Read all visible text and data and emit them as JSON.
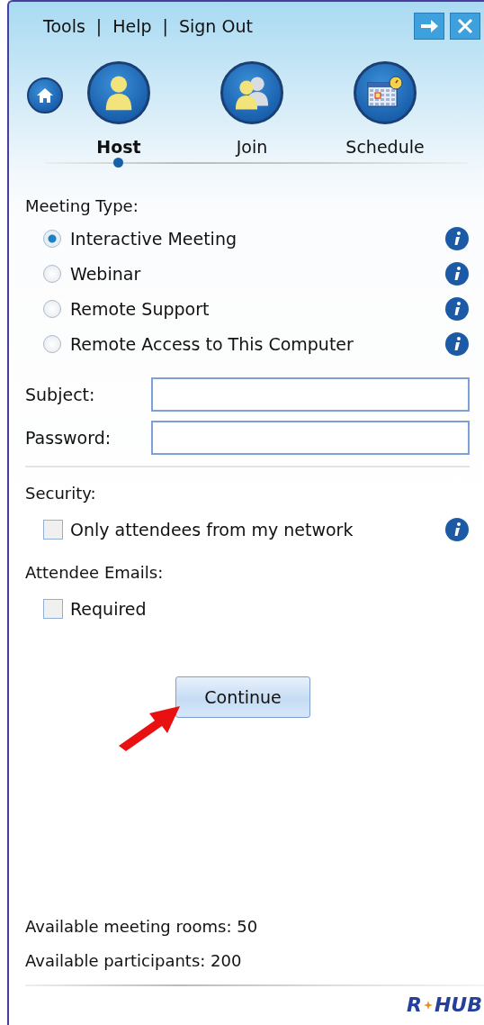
{
  "menu": [
    "Tools",
    "Help",
    "Sign Out"
  ],
  "menu_separators": [
    "|",
    "|"
  ],
  "nav": [
    {
      "label": "Host",
      "kind": "host",
      "selected": true
    },
    {
      "label": "Join",
      "kind": "join",
      "selected": false
    },
    {
      "label": "Schedule",
      "kind": "schedule",
      "selected": false
    }
  ],
  "meeting_type": {
    "label": "Meeting Type:",
    "options": [
      {
        "label": "Interactive Meeting",
        "selected": true
      },
      {
        "label": "Webinar",
        "selected": false
      },
      {
        "label": "Remote Support",
        "selected": false
      },
      {
        "label": "Remote Access to This Computer",
        "selected": false
      }
    ]
  },
  "fields": [
    {
      "label": "Subject:"
    },
    {
      "label": "Password:"
    }
  ],
  "security": {
    "label": "Security:",
    "option": {
      "label": "Only attendees from my network",
      "checked": false
    }
  },
  "attendee_emails": {
    "label": "Attendee Emails:",
    "option": {
      "label": "Required",
      "checked": false
    }
  },
  "continue_button": "Continue",
  "footer": [
    "Available meeting rooms: 50",
    "Available participants: 200"
  ],
  "logo": [
    "R",
    "HUB"
  ]
}
